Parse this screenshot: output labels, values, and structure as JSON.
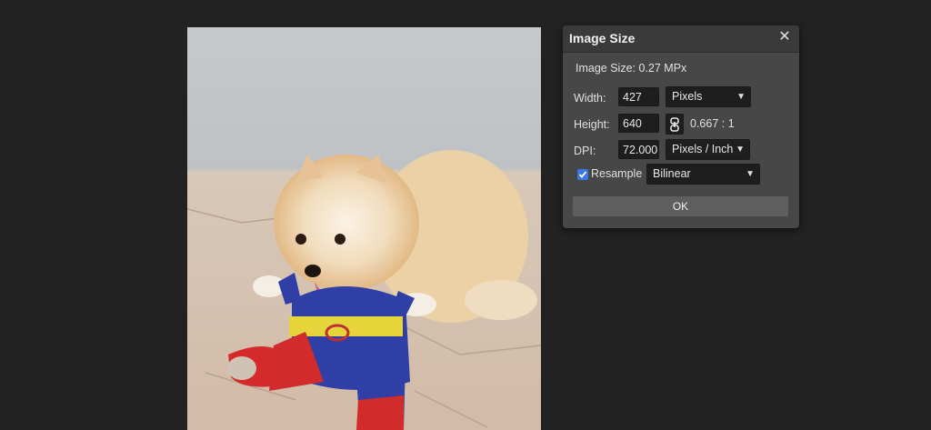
{
  "dialog": {
    "title": "Image Size",
    "close_icon": "close-icon",
    "info": "Image Size: 0.27 MPx",
    "width": {
      "label": "Width:",
      "value": "427",
      "unit": "Pixels"
    },
    "height": {
      "label": "Height:",
      "value": "640",
      "ratio": "0.667 : 1"
    },
    "dpi": {
      "label": "DPI:",
      "value": "72.000",
      "unit": "Pixels / Inch"
    },
    "resample": {
      "label": "Resample",
      "checked": true,
      "method": "Bilinear"
    },
    "ok_label": "OK"
  },
  "colors": {
    "background": "#222222",
    "dialog": "#474747",
    "field": "#1e1e1e",
    "checkbox": "#3b78e7"
  }
}
